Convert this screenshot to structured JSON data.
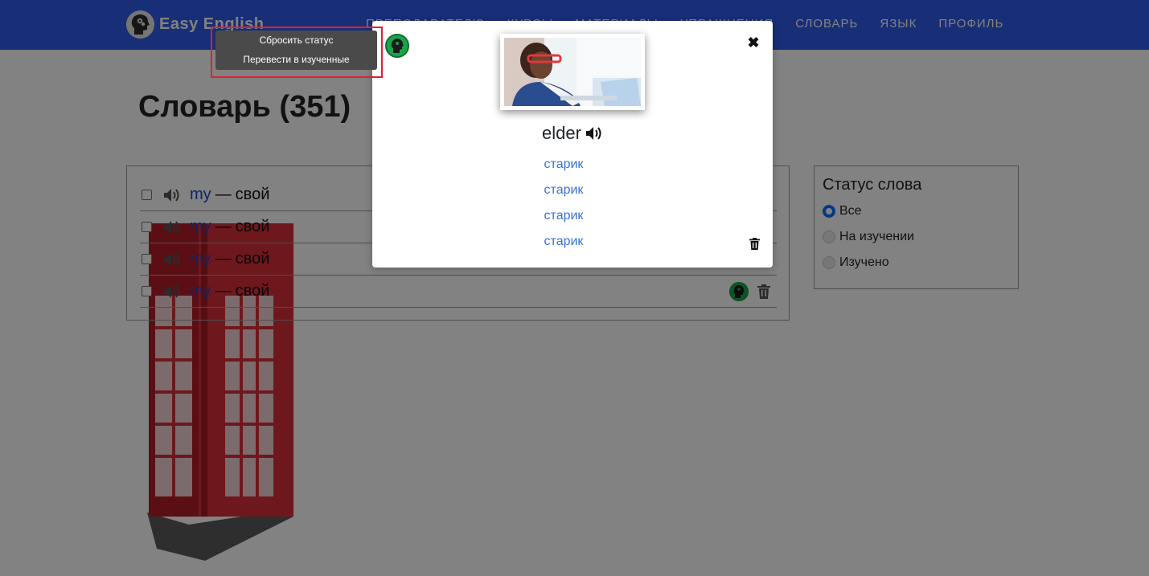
{
  "nav": {
    "brand": "Easy English",
    "links": [
      "ПРЕПОДАВАТЕЛЮ",
      "КУРСЫ",
      "МАТЕРИАЛЫ",
      "УПРАЖНЕНИЯ",
      "СЛОВАРЬ",
      "ЯЗЫК",
      "ПРОФИЛЬ"
    ]
  },
  "page": {
    "title": "Словарь (351)"
  },
  "words": [
    {
      "en": "my",
      "dash": "—",
      "ru": "свой"
    },
    {
      "en": "my",
      "dash": "—",
      "ru": "свой"
    },
    {
      "en": "my",
      "dash": "—",
      "ru": "свой"
    },
    {
      "en": "my",
      "dash": "—",
      "ru": "свой"
    }
  ],
  "status_filter": {
    "title": "Статус слова",
    "options": [
      {
        "label": "Все",
        "checked": true
      },
      {
        "label": "На изучении",
        "checked": false
      },
      {
        "label": "Изучено",
        "checked": false
      }
    ]
  },
  "modal": {
    "word": "elder",
    "translations": [
      "старик",
      "старик",
      "старик",
      "старик"
    ]
  },
  "context_menu": {
    "items": [
      "Сбросить статус",
      "Перевести в изученные"
    ]
  },
  "colors": {
    "navbar": "#2f5bea",
    "link": "#3a6fd8",
    "status_learning": "#1aa34a",
    "highlight": "#e2202c"
  }
}
